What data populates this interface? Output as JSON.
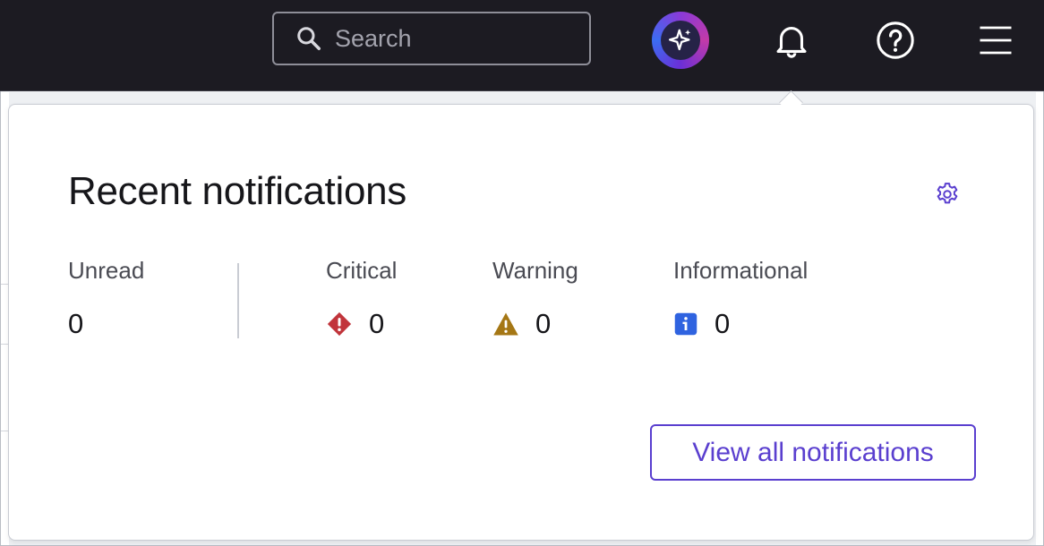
{
  "header": {
    "search": {
      "placeholder": "Search",
      "value": ""
    },
    "icons": [
      "search-icon",
      "ai-sparkle-icon",
      "bell-icon",
      "help-icon",
      "hamburger-menu-icon"
    ]
  },
  "notifications_popover": {
    "title": "Recent notifications",
    "settings_icon": "gear-icon",
    "stats": {
      "unread": {
        "label": "Unread",
        "value": "0"
      },
      "critical": {
        "label": "Critical",
        "value": "0",
        "icon": "critical-diamond-icon",
        "color": "#c1343b"
      },
      "warning": {
        "label": "Warning",
        "value": "0",
        "icon": "warning-triangle-icon",
        "color": "#a57715"
      },
      "informational": {
        "label": "Informational",
        "value": "0",
        "icon": "info-square-icon",
        "color": "#2f63e0"
      }
    },
    "view_all_label": "View all notifications"
  },
  "colors": {
    "topbar": "#1c1b22",
    "accent": "#5a3fcf"
  }
}
